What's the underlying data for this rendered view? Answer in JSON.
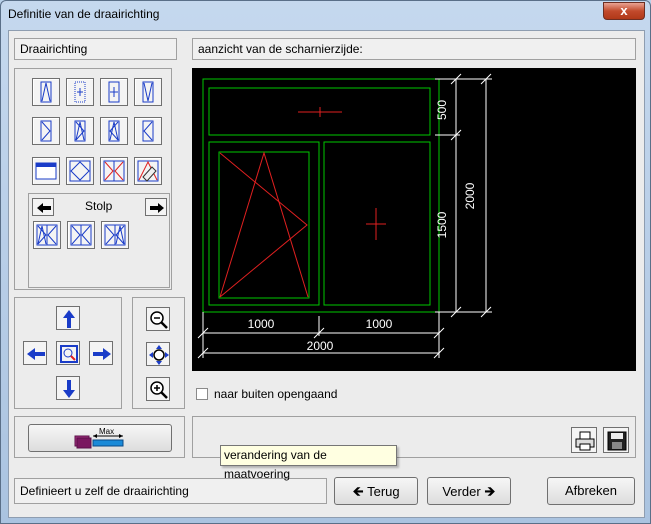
{
  "window": {
    "title": "Definitie van de draairichting",
    "close_glyph": "x"
  },
  "left_panel": {
    "header": "Draairichting",
    "stolp_label": "Stolp"
  },
  "right_panel": {
    "header": "aanzicht van de scharnierzijde:"
  },
  "drawing": {
    "dim_top": "500",
    "dim_mid": "1500",
    "dim_total_height": "2000",
    "dim_bottom_left": "1000",
    "dim_bottom_right": "1000",
    "dim_total_width": "2000"
  },
  "options": {
    "open_outward_label": "naar buiten opengaand",
    "open_outward_checked": false
  },
  "measure_button": {
    "label": "Max"
  },
  "tooltip": {
    "text": "verandering van de maatvoering"
  },
  "status": {
    "text": "Definieert u zelf de draairichting"
  },
  "buttons": {
    "back": "Terug",
    "next": "Verder",
    "cancel": "Afbreken"
  },
  "colors": {
    "frame": "#00c800",
    "hinge": "#ff2020",
    "dim": "#ffffff",
    "arrow": "#1a3cc8"
  }
}
